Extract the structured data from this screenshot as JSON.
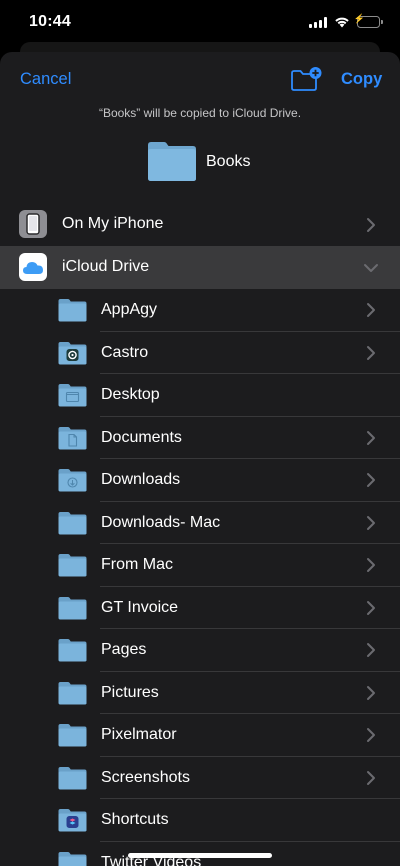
{
  "status_bar": {
    "time": "10:44"
  },
  "nav": {
    "cancel_label": "Cancel",
    "copy_label": "Copy"
  },
  "subtitle": "“Books” will be copied to iCloud Drive.",
  "document": {
    "name": "Books"
  },
  "locations": [
    {
      "label": "On My iPhone",
      "expanded": false
    },
    {
      "label": "iCloud Drive",
      "expanded": true,
      "selected": true
    }
  ],
  "folders": [
    {
      "label": "AppAgy",
      "badge": "none",
      "chevron": true
    },
    {
      "label": "Castro",
      "badge": "castro-app-icon",
      "chevron": true
    },
    {
      "label": "Desktop",
      "badge": "desktop-icon",
      "chevron": false
    },
    {
      "label": "Documents",
      "badge": "document-icon",
      "chevron": true
    },
    {
      "label": "Downloads",
      "badge": "download-icon",
      "chevron": true
    },
    {
      "label": "Downloads- Mac",
      "badge": "none",
      "chevron": true
    },
    {
      "label": "From Mac",
      "badge": "none",
      "chevron": true
    },
    {
      "label": "GT Invoice",
      "badge": "none",
      "chevron": true
    },
    {
      "label": "Pages",
      "badge": "none",
      "chevron": true
    },
    {
      "label": "Pictures",
      "badge": "none",
      "chevron": true
    },
    {
      "label": "Pixelmator",
      "badge": "none",
      "chevron": true
    },
    {
      "label": "Screenshots",
      "badge": "none",
      "chevron": true
    },
    {
      "label": "Shortcuts",
      "badge": "shortcuts-app-icon",
      "chevron": false
    },
    {
      "label": "Twitter Videos",
      "badge": "none",
      "chevron": false
    }
  ],
  "colors": {
    "accent": "#2f8cff",
    "folder": "#7bb4dc",
    "sheet_background": "#1c1c1e",
    "selected_row": "#3a3a3c",
    "battery": "#4cd964"
  }
}
